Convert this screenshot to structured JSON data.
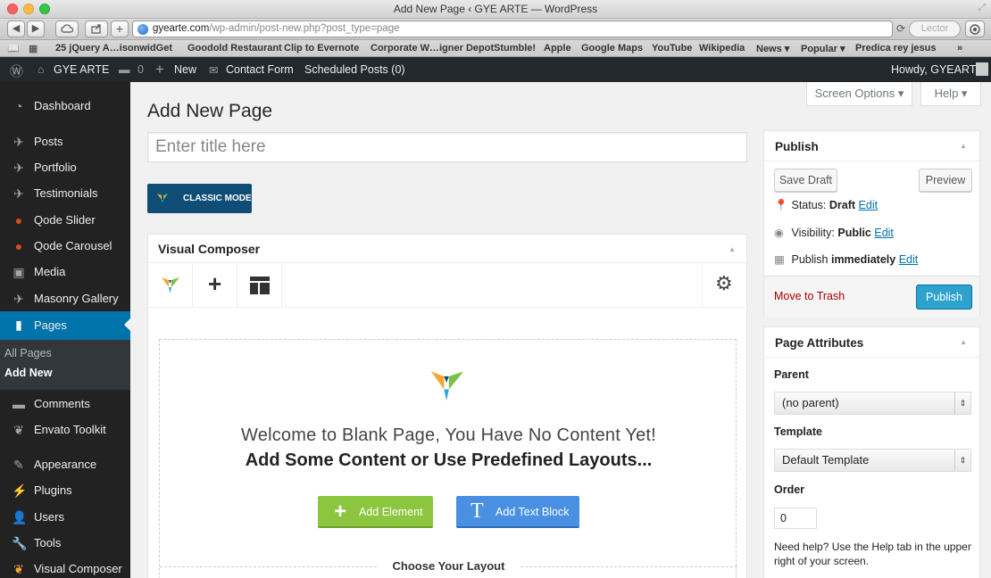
{
  "browser": {
    "window_title": "Add New Page ‹ GYE ARTE — WordPress",
    "url_domain": "gyearte.com",
    "url_path": "/wp-admin/post-new.php?post_type=page",
    "reader_label": "Lector",
    "reload_icon": "reload-icon",
    "bookmarks": [
      "25 jQuery A…isonwidGet",
      "Goodold Restaurant",
      "Clip to Evernote",
      "Corporate W…igner Depot",
      "Stumble!",
      "Apple",
      "Google Maps",
      "YouTube",
      "Wikipedia",
      "News ▾",
      "Popular ▾",
      "Predica rey jesus",
      "»"
    ]
  },
  "adminbar": {
    "site_name": "GYE ARTE",
    "comments_count": "0",
    "new_label": "New",
    "contact_form": "Contact Form",
    "scheduled": "Scheduled Posts (0)",
    "howdy": "Howdy, GYEARTE"
  },
  "sidebar": {
    "items": [
      {
        "label": "Dashboard",
        "icon": "dashboard-icon"
      },
      {
        "label": "Posts",
        "icon": "pin-icon"
      },
      {
        "label": "Portfolio",
        "icon": "pin-icon"
      },
      {
        "label": "Testimonials",
        "icon": "pin-icon"
      },
      {
        "label": "Qode Slider",
        "icon": "qode-icon"
      },
      {
        "label": "Qode Carousel",
        "icon": "qode-icon"
      },
      {
        "label": "Media",
        "icon": "media-icon"
      },
      {
        "label": "Masonry Gallery",
        "icon": "pin-icon"
      },
      {
        "label": "Pages",
        "icon": "pages-icon"
      },
      {
        "label": "Comments",
        "icon": "comments-icon"
      },
      {
        "label": "Envato Toolkit",
        "icon": "envato-icon"
      },
      {
        "label": "Appearance",
        "icon": "appearance-icon"
      },
      {
        "label": "Plugins",
        "icon": "plugins-icon"
      },
      {
        "label": "Users",
        "icon": "users-icon"
      },
      {
        "label": "Tools",
        "icon": "tools-icon"
      },
      {
        "label": "Visual Composer",
        "icon": "vc-icon"
      }
    ],
    "submenu": [
      "All Pages",
      "Add New"
    ]
  },
  "main": {
    "title": "Add New Page",
    "screen_options": "Screen Options ▾",
    "help": "Help ▾",
    "title_placeholder": "Enter title here",
    "classic_mode": "CLASSIC MODE",
    "vc": {
      "heading": "Visual Composer",
      "welcome_line1": "Welcome to Blank Page, You Have No Content Yet!",
      "welcome_line2": "Add Some Content or Use Predefined Layouts...",
      "add_element": "Add Element",
      "add_text_block": "Add Text Block",
      "choose_layout": "Choose Your Layout"
    }
  },
  "publish": {
    "heading": "Publish",
    "save_draft": "Save Draft",
    "preview": "Preview",
    "status_label": "Status: ",
    "status_value": "Draft",
    "visibility_label": "Visibility: ",
    "visibility_value": "Public",
    "publish_label": "Publish ",
    "publish_value": "immediately",
    "edit": "Edit",
    "trash": "Move to Trash",
    "publish_button": "Publish"
  },
  "page_attributes": {
    "heading": "Page Attributes",
    "parent_label": "Parent",
    "parent_value": "(no parent)",
    "template_label": "Template",
    "template_value": "Default Template",
    "order_label": "Order",
    "order_value": "0",
    "help_text": "Need help? Use the Help tab in the upper right of your screen."
  },
  "colors": {
    "wp_blue": "#0073aa",
    "vc_green": "#8cc63f",
    "vc_blue": "#4a90e2",
    "trash_red": "#a00"
  }
}
